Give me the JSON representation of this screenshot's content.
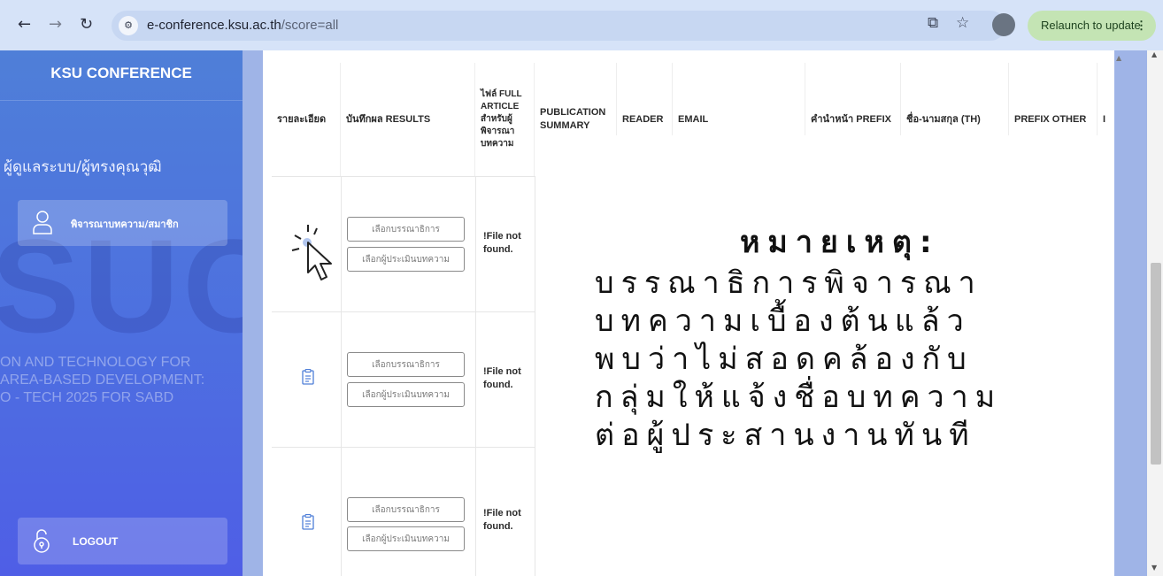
{
  "browser": {
    "url_host": "e-conference.ksu.ac.th",
    "url_path": "/score=all",
    "relaunch_label": "Relaunch to update"
  },
  "sidebar": {
    "brand": "KSU CONFERENCE",
    "section_label": "ผู้ดูแลระบบ/ผู้ทรงคุณวุฒิ",
    "active_item": "พิจารณาบทความ/สมาชิก",
    "watermark": "SUC",
    "watermark_lines": [
      "ON AND TECHNOLOGY FOR",
      " AREA-BASED DEVELOPMENT:",
      "O - TECH 2025 FOR SABD"
    ],
    "logout": "LOGOUT"
  },
  "table": {
    "headers": [
      "รายละเอียด",
      "บันทึกผล RESULTS",
      "ไฟล์ FULL ARTICLE สำหรับผู้พิจารณาบทความ",
      "PUBLICATION SUMMARY",
      "READER",
      "EMAIL",
      "คำนำหน้า PREFIX",
      "ชื่อ-นามสกุล (TH)",
      "PREFIX OTHER",
      "I"
    ],
    "rows": [
      {
        "select_editor": "เลือกบรรณาธิการ",
        "select_reviewer": "เลือกผู้ประเมินบทความ",
        "file": "!File not found."
      },
      {
        "select_editor": "เลือกบรรณาธิการ",
        "select_reviewer": "เลือกผู้ประเมินบทความ",
        "file": "!File not found."
      },
      {
        "select_editor": "เลือกบรรณาธิการ",
        "select_reviewer": "เลือกผู้ประเมินบทความ",
        "file": "!File not found."
      }
    ]
  },
  "note": {
    "title": "หมายเหตุ:",
    "body": "บรรณาธิการพิจารณา\nบทความเบื้องต้นแล้ว\nพบว่าไม่สอดคล้องกับ\nกลุ่มให้แจ้งชื่อบทความ\nต่อผู้ประสานงานทันที"
  },
  "colors": {
    "sidebar_top": "#4f7fd8",
    "sidebar_bottom": "#4f5ee6",
    "relaunch_bg": "#c4e4b4"
  }
}
